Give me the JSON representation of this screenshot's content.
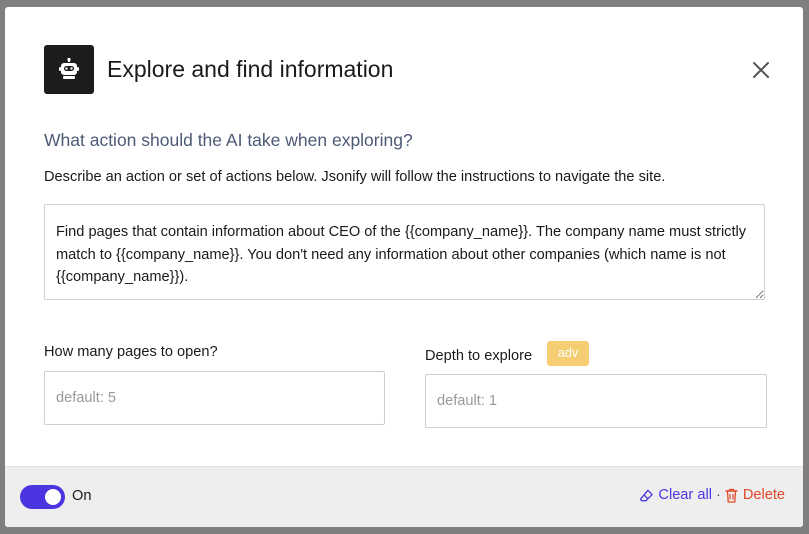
{
  "header": {
    "title": "Explore and find information",
    "icon": "robot-icon",
    "close_icon": "close-icon"
  },
  "question": "What action should the AI take when exploring?",
  "description": "Describe an action or set of actions below. Jsonify will follow the instructions to navigate the site.",
  "instructions": {
    "value": "Find pages that contain information about CEO of the {{company_name}}. The company name must strictly match to {{company_name}}. You don't need any information about other companies (which name is not {{company_name}})."
  },
  "pages_to_open": {
    "label": "How many pages to open?",
    "placeholder": "default: 5",
    "value": ""
  },
  "depth": {
    "label": "Depth to explore",
    "badge": "adv",
    "placeholder": "default: 1",
    "value": ""
  },
  "footer": {
    "toggle_state": "on",
    "toggle_label": "On",
    "clear_all_label": "Clear all",
    "clear_all_icon": "eraser-icon",
    "separator": "·",
    "delete_label": "Delete",
    "delete_icon": "trash-icon"
  },
  "colors": {
    "accent": "#4a35e0",
    "danger": "#e2482a",
    "badge": "#f5cd73",
    "question_text": "#4d5a75",
    "icon_box": "#1c1c1c"
  }
}
